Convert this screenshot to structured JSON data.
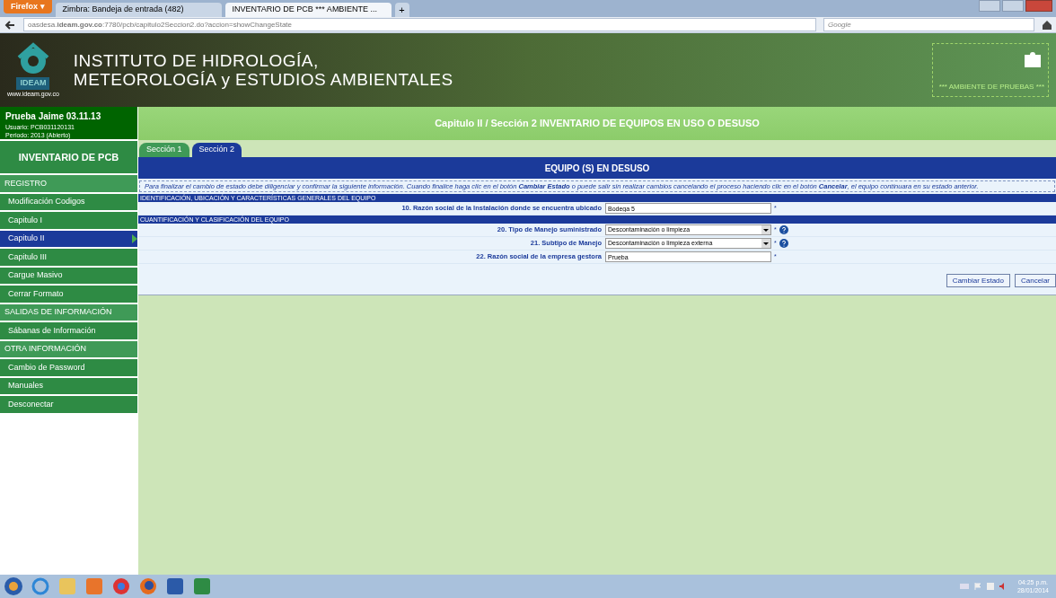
{
  "browser": {
    "menu_button": "Firefox ▾",
    "tabs": [
      {
        "label": "Zimbra: Bandeja de entrada (482)",
        "selected": false
      },
      {
        "label": "INVENTARIO DE PCB *** AMBIENTE ...",
        "selected": true
      }
    ],
    "new_tab": "+",
    "url_host_before": "oasdesa.",
    "url_host_bold": "ideam.gov.co",
    "url_rest": ":7780/pcb/capitulo2Seccion2.do?accion=showChangeState",
    "search_placeholder": "Google"
  },
  "banner": {
    "title_lines": [
      "INSTITUTO DE HIDROLOGÍA,",
      "METEOROLOGÍA y ESTUDIOS AMBIENTALES"
    ],
    "logo_text": "IDEAM",
    "site": "www.ideam.gov.co",
    "env_label": "*** AMBIENTE DE PRUEBAS ***"
  },
  "user": {
    "name": "Prueba Jaime 03.11.13",
    "usuario": "Usuario: PCB031120131",
    "periodo": "Periodo: 2013 (Abierto)"
  },
  "sidebar": {
    "title": "INVENTARIO DE PCB",
    "items": [
      {
        "label": "REGISTRO",
        "kind": "heading",
        "selected": false
      },
      {
        "label": "Modificación Codigos",
        "kind": "link",
        "selected": false
      },
      {
        "label": "Capitulo I",
        "kind": "link",
        "selected": false
      },
      {
        "label": "Capitulo II",
        "kind": "link",
        "selected": true
      },
      {
        "label": "Capitulo III",
        "kind": "link",
        "selected": false
      },
      {
        "label": "Cargue Masivo",
        "kind": "link",
        "selected": false
      },
      {
        "label": "Cerrar Formato",
        "kind": "link",
        "selected": false
      },
      {
        "label": "SALIDAS DE INFORMACIÓN",
        "kind": "heading",
        "selected": false
      },
      {
        "label": "Sábanas de Información",
        "kind": "link",
        "selected": false
      },
      {
        "label": "OTRA INFORMACIÓN",
        "kind": "heading",
        "selected": false
      },
      {
        "label": "Cambio de Password",
        "kind": "link",
        "selected": false
      },
      {
        "label": "Manuales",
        "kind": "link",
        "selected": false
      },
      {
        "label": "Desconectar",
        "kind": "link",
        "selected": false
      }
    ]
  },
  "page_title": "Capitulo II / Sección 2 INVENTARIO DE EQUIPOS EN USO O DESUSO",
  "section_tabs": [
    {
      "label": "Sección 1",
      "selected": false
    },
    {
      "label": "Sección 2",
      "selected": true
    }
  ],
  "panel": {
    "title": "EQUIPO (S) EN DESUSO",
    "notice": "Para finalizar el cambio de estado debe diligenciar y confirmar la siguiente información. Cuando finalice haga clic en el botón **Cambiar Estado** o puede salir sin realizar cambios cancelando el proceso haciendo clic en el botón **Cancelar**, el equipo continuara en su estado anterior.",
    "groups": [
      {
        "heading": "IDENTIFICACIÓN, UBICACIÓN Y CARACTERÍSTICAS GENERALES DEL EQUIPO",
        "fields": [
          {
            "label": "10. Razón social de la Instalación donde se encuentra ubicado",
            "kind": "text",
            "value": "Bodega 5",
            "required": "*",
            "help": false
          }
        ]
      },
      {
        "heading": "CUANTIFICACIÓN Y CLASIFICACIÓN DEL EQUIPO",
        "fields": [
          {
            "label": "20. Tipo de Manejo suministrado",
            "kind": "select",
            "value": "Descontaminación o limpieza",
            "required": "*",
            "help": true
          },
          {
            "label": "21. Subtipo de Manejo",
            "kind": "select",
            "value": "Descontaminación o limpieza externa",
            "required": "*",
            "help": true
          },
          {
            "label": "22. Razón social de la empresa gestora",
            "kind": "text",
            "value": "Prueba",
            "required": "*",
            "help": false
          }
        ]
      }
    ],
    "buttons": [
      "Cambiar Estado",
      "Cancelar"
    ]
  },
  "taskbar": {
    "time": "04:25 p.m.",
    "date": "28/01/2014"
  }
}
